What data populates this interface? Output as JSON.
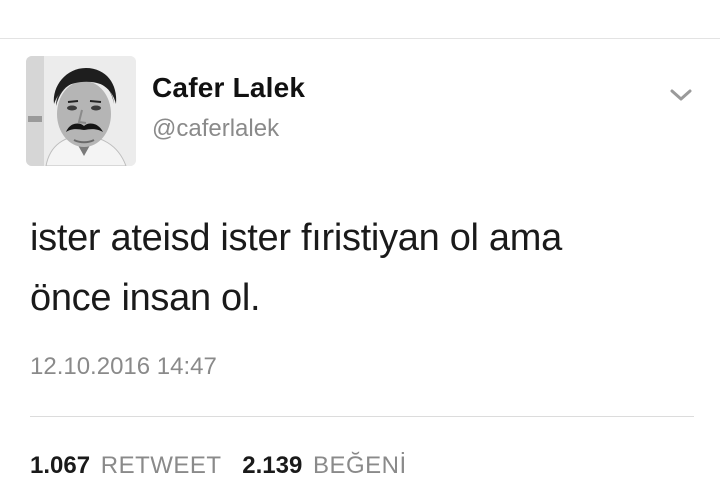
{
  "tweet": {
    "author": {
      "name": "Cafer Lalek",
      "handle": "@caferlalek",
      "avatar": "user-avatar-photo"
    },
    "menu_icon": "chevron-down-icon",
    "text_line_1": "ister ateisd ister fıristiyan ol ama",
    "text_line_2": "önce insan ol.",
    "timestamp": "12.10.2016 14:47",
    "stats": {
      "retweet_count": "1.067",
      "retweet_label": "RETWEET",
      "like_count": "2.139",
      "like_label": "BEĞENİ"
    }
  },
  "colors": {
    "text": "#1a1a1a",
    "secondary_text": "#8a8a8a",
    "divider": "#dcdcdc"
  }
}
